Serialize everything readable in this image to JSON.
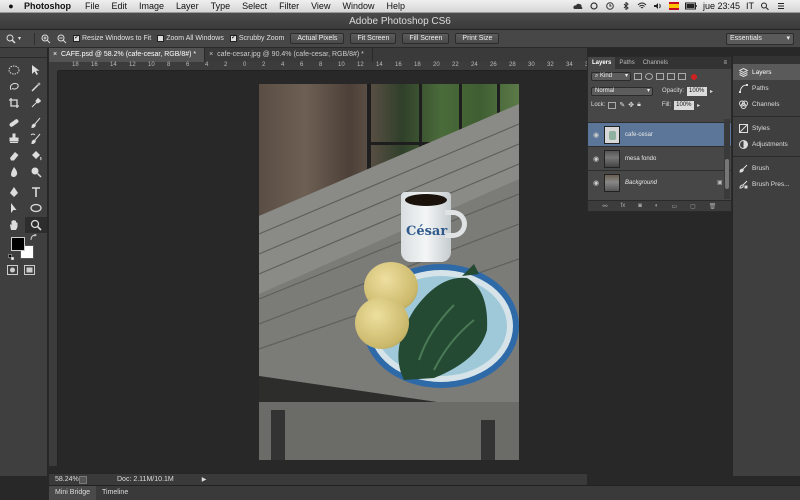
{
  "menubar": {
    "app_name": "Photoshop",
    "items": [
      "File",
      "Edit",
      "Image",
      "Layer",
      "Type",
      "Select",
      "Filter",
      "View",
      "Window",
      "Help"
    ],
    "clock": "jue 23:45",
    "lang": "IT"
  },
  "window": {
    "title": "Adobe Photoshop CS6"
  },
  "options": {
    "resize_windows": "Resize Windows to Fit",
    "zoom_all": "Zoom All Windows",
    "scrubby_zoom": "Scrubby Zoom",
    "actual_pixels": "Actual Pixels",
    "fit_screen": "Fit Screen",
    "fill_screen": "Fill Screen",
    "print_size": "Print Size",
    "workspace": "Essentials"
  },
  "documents": {
    "tabs": [
      {
        "label": "CAFE.psd @ 58.2% (cafe-cesar, RGB/8#) *"
      },
      {
        "label": "cafe-cesar.jpg @ 90.4% (cafe-cesar, RGB/8#) *"
      }
    ]
  },
  "ruler": {
    "ticks": [
      "18",
      "16",
      "14",
      "12",
      "10",
      "8",
      "6",
      "4",
      "2",
      "0",
      "2",
      "4",
      "6",
      "8",
      "10",
      "12",
      "14",
      "16",
      "18",
      "20",
      "22",
      "24",
      "26",
      "28",
      "30",
      "32",
      "34",
      "36"
    ]
  },
  "photo": {
    "mug_text": "César"
  },
  "status": {
    "zoom": "58.24%",
    "doc": "Doc: 2.11M/10.1M"
  },
  "bottom_tabs": [
    "Mini Bridge",
    "Timeline"
  ],
  "layers_panel": {
    "tabs": [
      "Layers",
      "Paths",
      "Channels"
    ],
    "kind": "Kind",
    "blend_mode": "Normal",
    "opacity_label": "Opacity:",
    "opacity": "100%",
    "lock_label": "Lock:",
    "fill_label": "Fill:",
    "fill": "100%",
    "layers": [
      {
        "name": "cafe-cesar",
        "selected": true
      },
      {
        "name": "mesa fondo",
        "selected": false
      },
      {
        "name": "Background",
        "selected": false,
        "locked": true
      }
    ]
  },
  "dock": {
    "items": [
      "Layers",
      "Paths",
      "Channels",
      "Styles",
      "Adjustments",
      "Brush",
      "Brush Pres..."
    ]
  }
}
